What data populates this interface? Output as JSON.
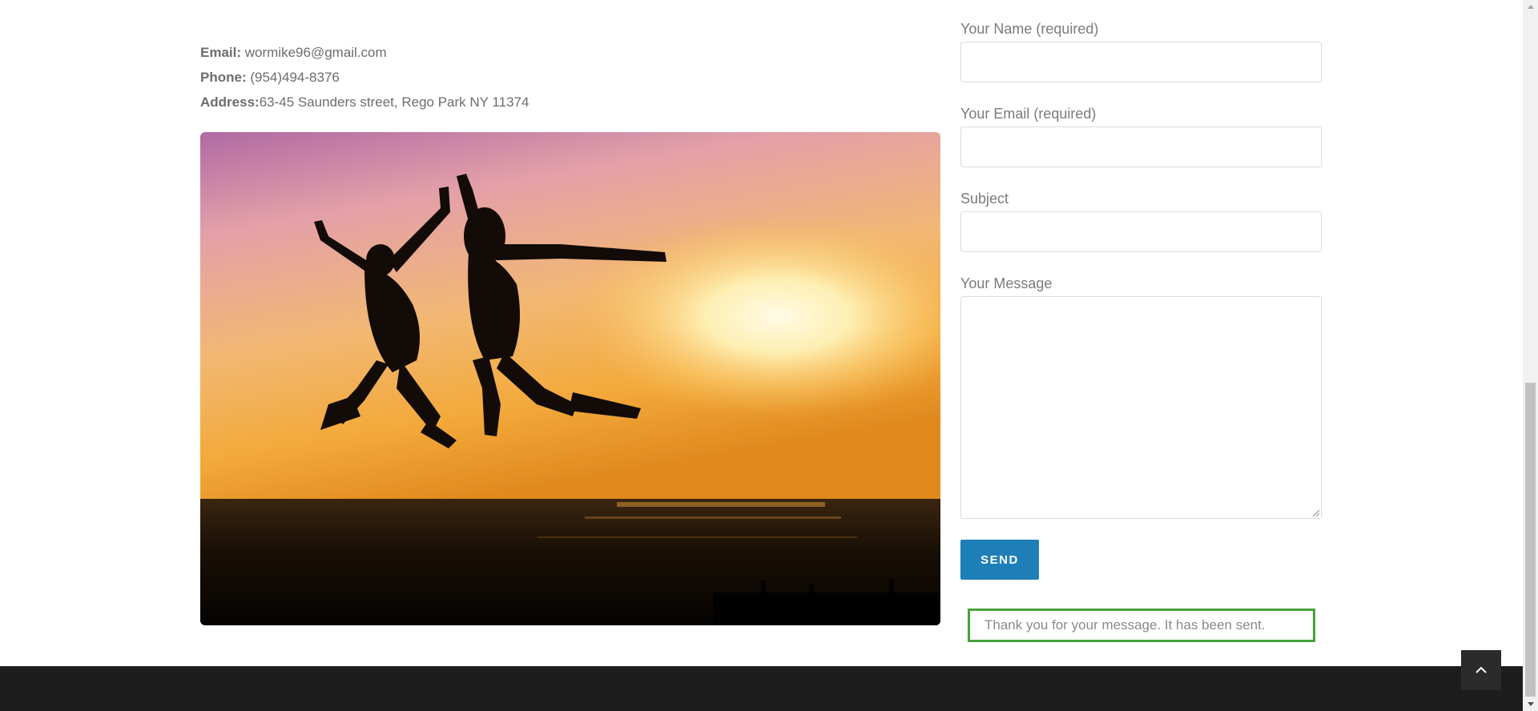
{
  "contact": {
    "email_label": "Email:",
    "email_value": " wormike96@gmail.com",
    "phone_label": "Phone:",
    "phone_value": " (954)494-8376",
    "address_label": "Address:",
    "address_value": "63-45 Saunders street, Rego Park NY 11374"
  },
  "form": {
    "name_label": "Your Name (required)",
    "email_label": "Your Email (required)",
    "subject_label": "Subject",
    "message_label": "Your Message",
    "name_value": "",
    "email_value": "",
    "subject_value": "",
    "message_value": "",
    "send_label": "SEND",
    "response_message": "Thank you for your message. It has been sent."
  },
  "icons": {
    "back_to_top": "chevron-up-icon",
    "scroll_down": "triangle-down-icon"
  },
  "colors": {
    "send_button": "#1e7fb8",
    "success_border": "#46a33a",
    "footer": "#1d1d1d"
  }
}
